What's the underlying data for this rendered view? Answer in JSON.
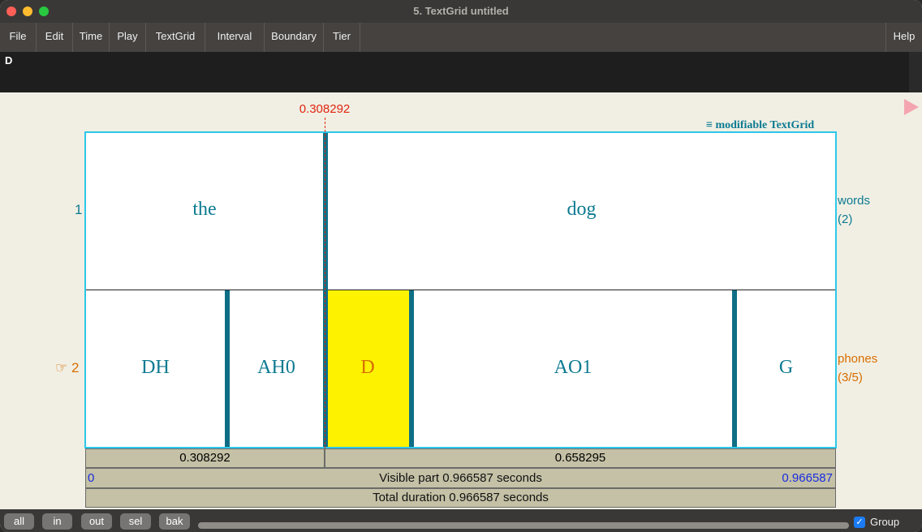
{
  "window": {
    "title": "5. TextGrid untitled"
  },
  "menubar": {
    "items": [
      "File",
      "Edit",
      "Time",
      "Play",
      "TextGrid",
      "Interval",
      "Boundary",
      "Tier"
    ],
    "help": "Help"
  },
  "editor": {
    "text": "D"
  },
  "cursor": {
    "time": "0.308292"
  },
  "header": {
    "mod_icon": "≡",
    "mod_label": "modifiable TextGrid"
  },
  "tiers": [
    {
      "number": "1",
      "name": "words",
      "count": "(2)",
      "intervals": [
        "the",
        "dog"
      ]
    },
    {
      "number": "2",
      "pointer": "☞",
      "name": "phones",
      "count": "(3/5)",
      "intervals": [
        "DH",
        "AH0",
        "D",
        "AO1",
        "G"
      ]
    }
  ],
  "timebars": {
    "seg_left": "0.308292",
    "seg_right": "0.658295",
    "visible_start": "0",
    "visible_label": "Visible part 0.966587 seconds",
    "visible_end": "0.966587",
    "total_label": "Total duration 0.966587 seconds"
  },
  "bottom": {
    "buttons": [
      "all",
      "in",
      "out",
      "sel",
      "bak"
    ],
    "group_label": "Group",
    "group_checked": true
  },
  "colors": {
    "tier_text": "#0c7a91",
    "active": "#d86e00",
    "cursor": "#e0250f",
    "selection": "#fdf200",
    "frame": "#2cc8ea",
    "visible_time": "#1a2de0"
  }
}
